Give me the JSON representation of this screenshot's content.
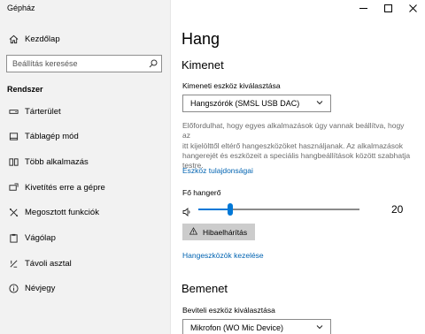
{
  "window": {
    "title": "Gépház"
  },
  "sidebar": {
    "home_label": "Kezdőlap",
    "search_placeholder": "Beállítás keresése",
    "section": "Rendszer",
    "items": [
      {
        "label": "Tárterület",
        "icon": "storage-icon"
      },
      {
        "label": "Táblagép mód",
        "icon": "tablet-icon"
      },
      {
        "label": "Több alkalmazás",
        "icon": "multitasking-icon"
      },
      {
        "label": "Kivetítés erre a gépre",
        "icon": "project-icon"
      },
      {
        "label": "Megosztott funkciók",
        "icon": "shared-experiences-icon"
      },
      {
        "label": "Vágólap",
        "icon": "clipboard-icon"
      },
      {
        "label": "Távoli asztal",
        "icon": "remote-desktop-icon"
      },
      {
        "label": "Névjegy",
        "icon": "info-icon"
      }
    ]
  },
  "main": {
    "title": "Hang",
    "output": {
      "heading": "Kimenet",
      "device_label": "Kimeneti eszköz kiválasztása",
      "device_value": "Hangszórók (SMSL USB DAC)",
      "description_lines": [
        "Előfordulhat, hogy egyes alkalmazások úgy vannak beállítva, hogy az",
        "itt kijelölttől eltérő hangeszközöket használjanak. Az alkalmazások",
        "hangerejét és eszközeit a speciális hangbeállítások között szabhatja",
        "testre."
      ],
      "properties_link": "Eszköz tulajdonságai",
      "volume_label": "Fő hangerő",
      "volume_value": "20",
      "volume_fraction": 0.2,
      "troubleshoot_label": "Hibaelhárítás",
      "manage_link": "Hangeszközök kezelése"
    },
    "input": {
      "heading": "Bemenet",
      "device_label": "Beviteli eszköz kiválasztása",
      "device_value": "Mikrofon (WO Mic Device)"
    }
  },
  "colors": {
    "accent": "#0078d7",
    "link": "#0063b1",
    "sidebar_bg": "#f2f2f2",
    "button_bg": "#cccccc"
  }
}
